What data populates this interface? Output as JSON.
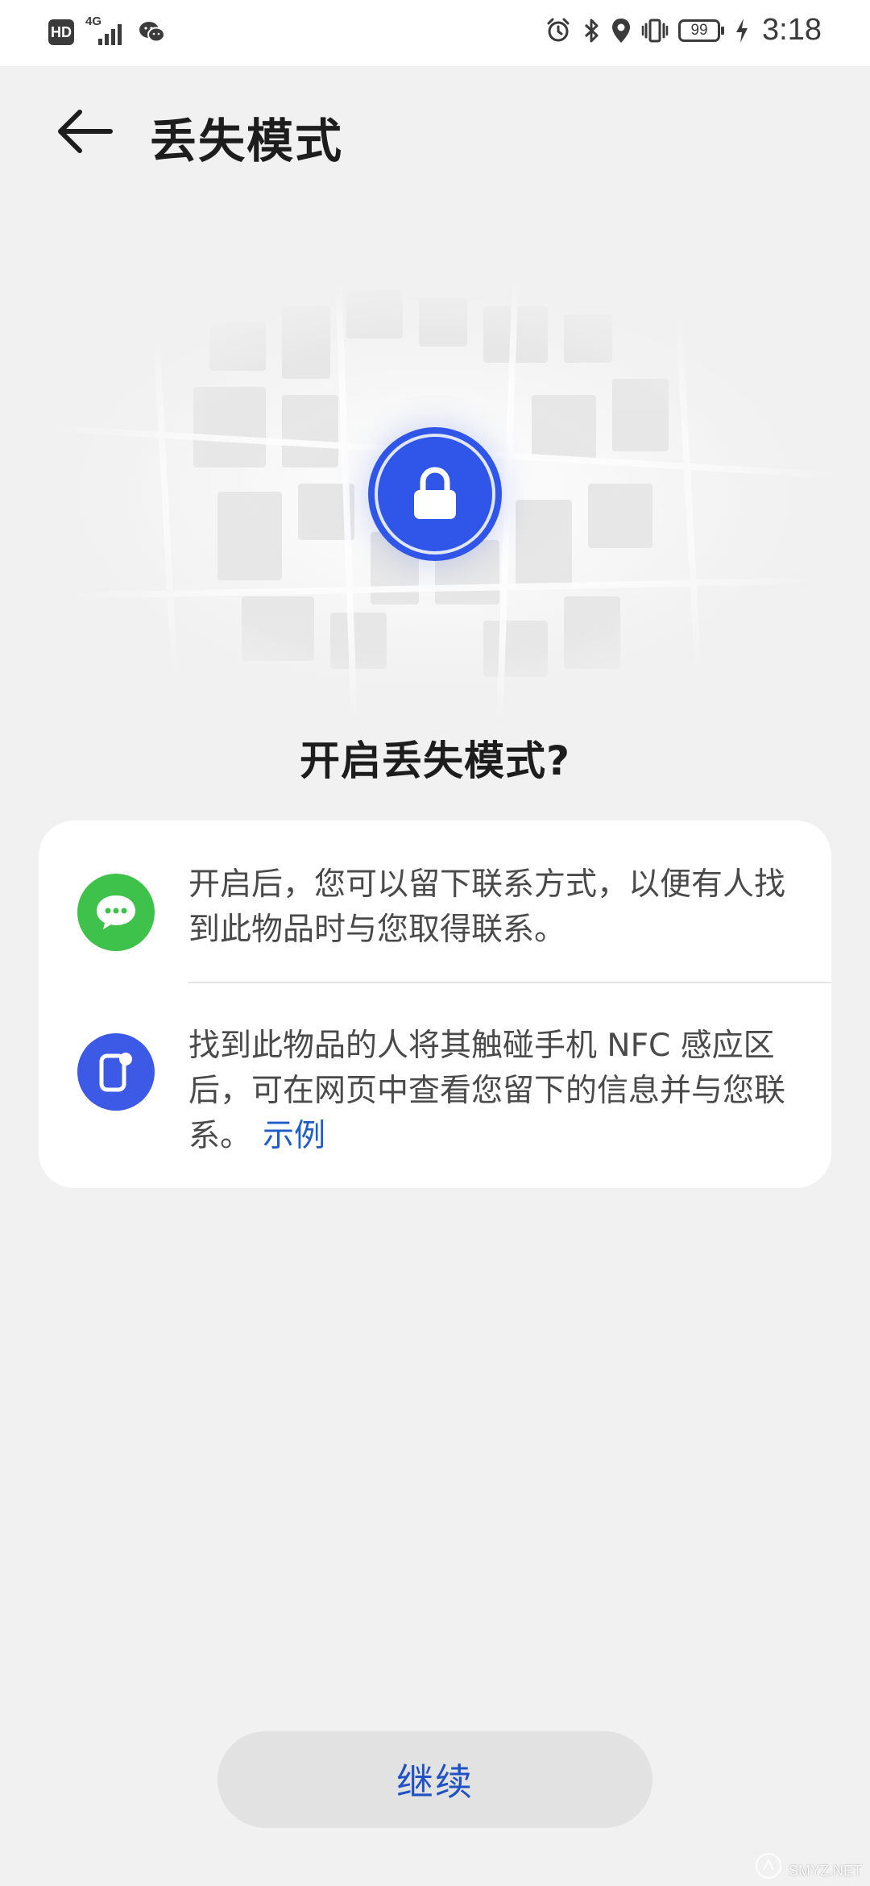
{
  "status_bar": {
    "hd": "HD",
    "network": "4G",
    "battery": "99",
    "time": "3:18"
  },
  "header": {
    "title": "丢失模式"
  },
  "main": {
    "question": "开启丢失模式?",
    "info_items": [
      {
        "icon": "message-bubble-icon",
        "icon_color": "#3ec24b",
        "text": "开启后，您可以留下联系方式，以便有人找到此物品时与您取得联系。"
      },
      {
        "icon": "nfc-phone-icon",
        "icon_color": "#3c5ae6",
        "text": "找到此物品的人将其触碰手机 NFC 感应区后，可在网页中查看您留下的信息并与您联系。",
        "link": "示例"
      }
    ],
    "continue_label": "继续"
  },
  "colors": {
    "accent": "#2f56e8",
    "link": "#1e5dc8",
    "background": "#f1f1f1"
  },
  "watermark": {
    "text": "SMYZ.NET"
  }
}
